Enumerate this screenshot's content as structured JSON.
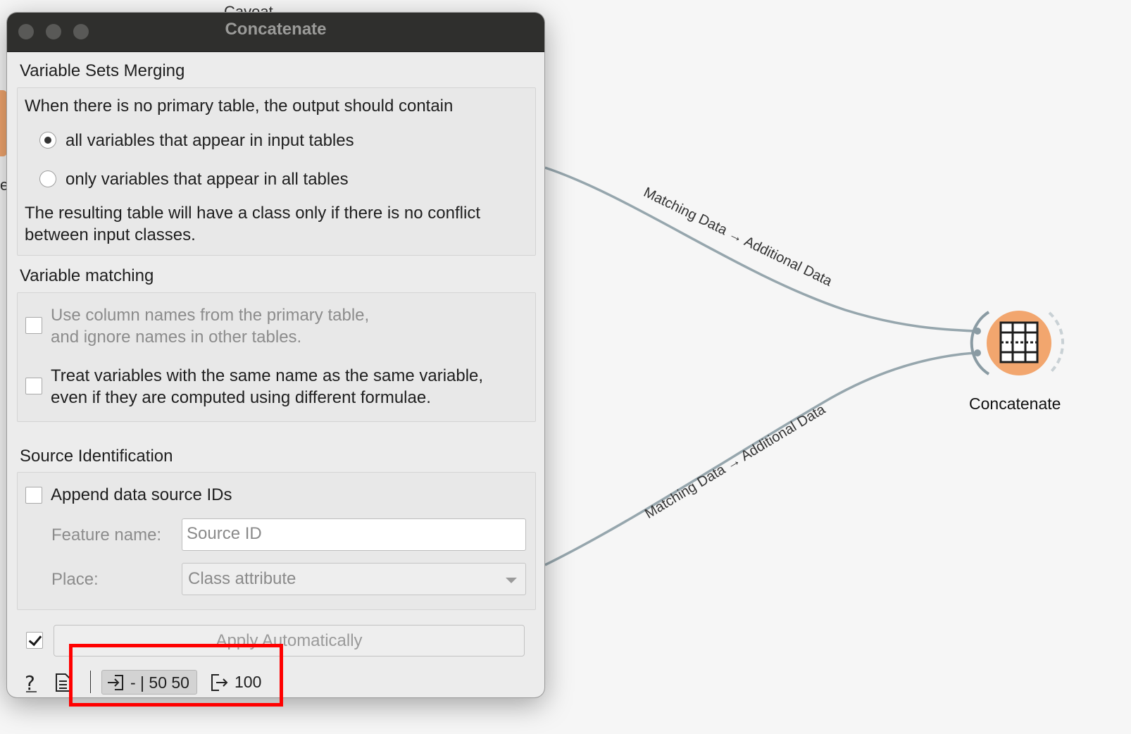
{
  "canvas": {
    "partial_top_label": "Caveat",
    "partial_left_label": "e",
    "links": [
      {
        "label": "Matching Data → Additional Data"
      },
      {
        "label": "Matching Data → Additional Data"
      }
    ],
    "node": {
      "label": "Concatenate",
      "icon": "table-icon",
      "color": "#f2a66e"
    }
  },
  "window": {
    "title": "Concatenate",
    "merging": {
      "title": "Variable Sets Merging",
      "prompt": "When there is no primary table, the output should contain",
      "options": [
        {
          "label": "all variables that appear in input tables",
          "checked": true
        },
        {
          "label": "only variables that appear in all tables",
          "checked": false
        }
      ],
      "note_line1": "The resulting table will have a class only if there is no conflict",
      "note_line2": "between input classes."
    },
    "matching": {
      "title": "Variable matching",
      "use_primary_line1": "Use column names from the primary table,",
      "use_primary_line2": "and ignore names in other tables.",
      "use_primary_checked": false,
      "treat_same_line1": "Treat variables with the same name as the same variable,",
      "treat_same_line2": "even if they are computed using different formulae.",
      "treat_same_checked": false
    },
    "source": {
      "title": "Source Identification",
      "append_label": "Append data source IDs",
      "append_checked": false,
      "feature_label": "Feature name:",
      "feature_value": "Source ID",
      "place_label": "Place:",
      "place_value": "Class attribute"
    },
    "footer": {
      "apply_checked": true,
      "apply_label": "Apply Automatically",
      "input_summary": "- | 50 50",
      "output_summary": "100"
    }
  }
}
